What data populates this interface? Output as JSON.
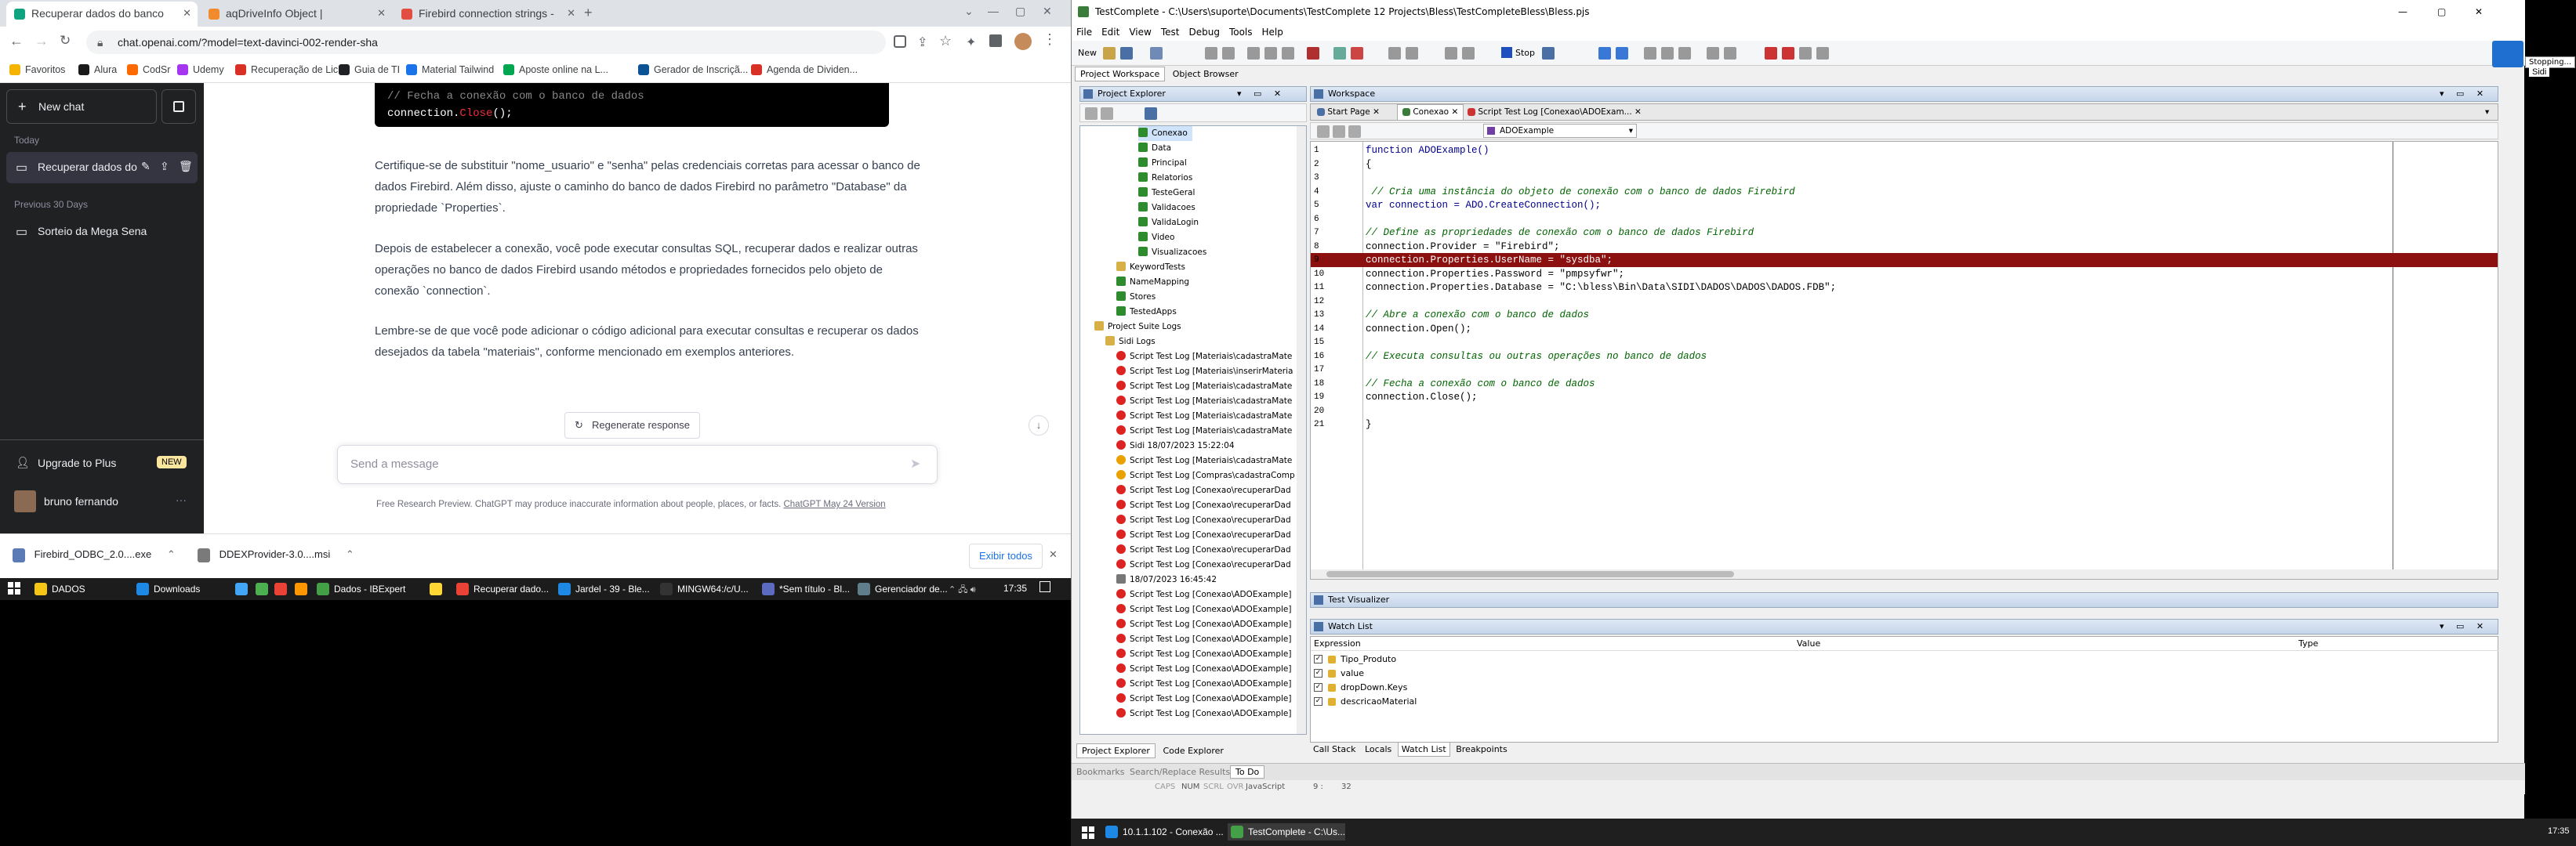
{
  "browser": {
    "tabs": [
      {
        "label": "Recuperar dados do banco",
        "color": "#10a37f"
      },
      {
        "label": "aqDriveInfo Object | TestComplete",
        "color": "#f28b2e"
      },
      {
        "label": "Firebird connection strings - Conn",
        "color": "#e24e42"
      }
    ],
    "url": "chat.openai.com/?model=text-davinci-002-render-sha",
    "bookmarks": [
      {
        "label": "Favoritos",
        "color": "#f5b400"
      },
      {
        "label": "Alura",
        "color": "#1a1a1a"
      },
      {
        "label": "CodSr",
        "color": "#ff6a00"
      },
      {
        "label": "Udemy",
        "color": "#a435f0"
      },
      {
        "label": "Recuperação de Lic...",
        "color": "#d93025"
      },
      {
        "label": "Guia de TI",
        "color": "#202124"
      },
      {
        "label": "Material Tailwind",
        "color": "#1a73e8"
      },
      {
        "label": "Aposte online na L...",
        "color": "#00a650"
      },
      {
        "label": "Gerador de Inscriçã...",
        "color": "#0b5394"
      },
      {
        "label": "Agenda de Dividen...",
        "color": "#d93025"
      }
    ]
  },
  "chatgpt": {
    "new_chat": "New chat",
    "today": "Today",
    "active_chat": "Recuperar dados do",
    "previous": "Previous 30 Days",
    "old_chat": "Sorteio da Mega Sena",
    "upgrade": "Upgrade to Plus",
    "new_badge": "NEW",
    "user": "bruno fernando",
    "code_comment": "// Fecha a conexão com o banco de dados",
    "code_line_1": "connection.",
    "code_line_2": "Close",
    "code_line_3": "();",
    "para1": "Certifique-se de substituir \"nome_usuario\" e \"senha\" pelas credenciais corretas para acessar o banco de dados Firebird. Além disso, ajuste o caminho do banco de dados Firebird no parâmetro \"Database\" da propriedade `Properties`.",
    "para2": "Depois de estabelecer a conexão, você pode executar consultas SQL, recuperar dados e realizar outras operações no banco de dados Firebird usando métodos e propriedades fornecidos pelo objeto de conexão `connection`.",
    "para3": "Lembre-se de que você pode adicionar o código adicional para executar consultas e recuperar os dados desejados da tabela \"materiais\", conforme mencionado em exemplos anteriores.",
    "regenerate": "Regenerate response",
    "placeholder": "Send a message",
    "disclaimer": "Free Research Preview. ChatGPT may produce inaccurate information about people, places, or facts.",
    "disclaimer_link": "ChatGPT May 24 Version"
  },
  "downloads": {
    "files": [
      "Firebird_ODBC_2.0....exe",
      "DDEXProvider-3.0....msi"
    ],
    "show_all": "Exibir todos"
  },
  "taskbar_left": {
    "items": [
      {
        "label": "DADOS",
        "color": "#f5c518"
      },
      {
        "label": "Downloads",
        "color": "#1e88e5"
      },
      {
        "label": "",
        "color": "#42a5f5"
      },
      {
        "label": "",
        "color": "#4caf50"
      },
      {
        "label": "",
        "color": "#ea4335"
      },
      {
        "label": "",
        "color": "#ff9800"
      },
      {
        "label": "Dados - IBExpert",
        "color": "#43a047"
      },
      {
        "label": "",
        "color": "#fdd835"
      },
      {
        "label": "Recuperar dado...",
        "color": "#ea4335"
      },
      {
        "label": "Jardel - 39 - Ble...",
        "color": "#1e88e5"
      },
      {
        "label": "MINGW64:/c/U...",
        "color": "#333"
      },
      {
        "label": "*Sem título - Bl...",
        "color": "#5c6bc0"
      },
      {
        "label": "Gerenciador de...",
        "color": "#607d8b"
      }
    ],
    "time": "17:35"
  },
  "testcomplete": {
    "title": "TestComplete - C:\\Users\\suporte\\Documents\\TestComplete 12 Projects\\Bless\\TestCompleteBless\\Bless.pjs",
    "menus": [
      "File",
      "Edit",
      "View",
      "Test",
      "Debug",
      "Tools",
      "Help"
    ],
    "new_label": "New",
    "stop_label": "Stop",
    "stopping_label": "Stopping...",
    "sidi_label": "Sidi",
    "tabs_top": [
      "Project Workspace",
      "Object Browser"
    ],
    "project_explorer": "Project Explorer",
    "tree": [
      {
        "label": "Conexao",
        "indent": 4,
        "icon": "check"
      },
      {
        "label": "Data",
        "indent": 4,
        "icon": "check"
      },
      {
        "label": "Principal",
        "indent": 4,
        "icon": "check"
      },
      {
        "label": "Relatorios",
        "indent": 4,
        "icon": "check"
      },
      {
        "label": "TesteGeral",
        "indent": 4,
        "icon": "check"
      },
      {
        "label": "Validacoes",
        "indent": 4,
        "icon": "check"
      },
      {
        "label": "ValidaLogin",
        "indent": 4,
        "icon": "check"
      },
      {
        "label": "Video",
        "indent": 4,
        "icon": "check"
      },
      {
        "label": "Visualizacoes",
        "indent": 4,
        "icon": "check"
      },
      {
        "label": "KeywordTests",
        "indent": 2,
        "icon": "folder"
      },
      {
        "label": "NameMapping",
        "indent": 2,
        "icon": "check"
      },
      {
        "label": "Stores",
        "indent": 2,
        "icon": "check"
      },
      {
        "label": "TestedApps",
        "indent": 2,
        "icon": "check"
      },
      {
        "label": "Project Suite Logs",
        "indent": 0,
        "icon": "folder"
      },
      {
        "label": "Sidi Logs",
        "indent": 1,
        "icon": "folder"
      },
      {
        "label": "Script Test Log [Materiais\\cadastraMate",
        "indent": 2,
        "icon": "err"
      },
      {
        "label": "Script Test Log [Materiais\\inserirMateria",
        "indent": 2,
        "icon": "err"
      },
      {
        "label": "Script Test Log [Materiais\\cadastraMate",
        "indent": 2,
        "icon": "err"
      },
      {
        "label": "Script Test Log [Materiais\\cadastraMate",
        "indent": 2,
        "icon": "err"
      },
      {
        "label": "Script Test Log [Materiais\\cadastraMate",
        "indent": 2,
        "icon": "err"
      },
      {
        "label": "Script Test Log [Materiais\\cadastraMate",
        "indent": 2,
        "icon": "err"
      },
      {
        "label": "Sidi 18/07/2023 15:22:04",
        "indent": 2,
        "icon": "err"
      },
      {
        "label": "Script Test Log [Materiais\\cadastraMate",
        "indent": 2,
        "icon": "warn"
      },
      {
        "label": "Script Test Log [Compras\\cadastraComp",
        "indent": 2,
        "icon": "warn"
      },
      {
        "label": "Script Test Log [Conexao\\recuperarDad",
        "indent": 2,
        "icon": "err"
      },
      {
        "label": "Script Test Log [Conexao\\recuperarDad",
        "indent": 2,
        "icon": "err"
      },
      {
        "label": "Script Test Log [Conexao\\recuperarDad",
        "indent": 2,
        "icon": "err"
      },
      {
        "label": "Script Test Log [Conexao\\recuperarDad",
        "indent": 2,
        "icon": "err"
      },
      {
        "label": "Script Test Log [Conexao\\recuperarDad",
        "indent": 2,
        "icon": "err"
      },
      {
        "label": "Script Test Log [Conexao\\recuperarDad",
        "indent": 2,
        "icon": "err"
      },
      {
        "label": "18/07/2023 16:45:42",
        "indent": 2,
        "icon": "doc"
      },
      {
        "label": "Script Test Log [Conexao\\ADOExample]",
        "indent": 2,
        "icon": "err"
      },
      {
        "label": "Script Test Log [Conexao\\ADOExample]",
        "indent": 2,
        "icon": "err"
      },
      {
        "label": "Script Test Log [Conexao\\ADOExample]",
        "indent": 2,
        "icon": "err"
      },
      {
        "label": "Script Test Log [Conexao\\ADOExample]",
        "indent": 2,
        "icon": "err"
      },
      {
        "label": "Script Test Log [Conexao\\ADOExample]",
        "indent": 2,
        "icon": "err"
      },
      {
        "label": "Script Test Log [Conexao\\ADOExample]",
        "indent": 2,
        "icon": "err"
      },
      {
        "label": "Script Test Log [Conexao\\ADOExample]",
        "indent": 2,
        "icon": "err"
      },
      {
        "label": "Script Test Log [Conexao\\ADOExample]",
        "indent": 2,
        "icon": "err"
      },
      {
        "label": "Script Test Log [Conexao\\ADOExample]",
        "indent": 2,
        "icon": "err"
      }
    ],
    "bottom_left_tabs": [
      "Project Explorer",
      "Code Explorer"
    ],
    "bottom_tabs": [
      "Bookmarks",
      "Search/Replace Results",
      "To Do"
    ],
    "workspace": "Workspace",
    "ws_tabs": [
      "Start Page",
      "Conexao",
      "Script Test Log [Conexao\\ADOExam..."
    ],
    "routine": "ADOExample",
    "code": [
      {
        "n": "1",
        "t": "function ADOExample()"
      },
      {
        "n": "2",
        "t": "{"
      },
      {
        "n": "3",
        "t": ""
      },
      {
        "n": "4",
        "t": " // Cria uma instância do objeto de conexão com o banco de dados Firebird"
      },
      {
        "n": "5",
        "t": "var connection = ADO.CreateConnection();"
      },
      {
        "n": "6",
        "t": ""
      },
      {
        "n": "7",
        "t": "// Define as propriedades de conexão com o banco de dados Firebird"
      },
      {
        "n": "8",
        "t": "connection.Provider = \"Firebird\";"
      },
      {
        "n": "9",
        "t": "connection.Properties.UserName = \"sysdba\";"
      },
      {
        "n": "10",
        "t": "connection.Properties.Password = \"pmpsyfwr\";"
      },
      {
        "n": "11",
        "t": "connection.Properties.Database = \"C:\\bless\\Bin\\Data\\SIDI\\DADOS\\DADOS\\DADOS.FDB\";"
      },
      {
        "n": "12",
        "t": ""
      },
      {
        "n": "13",
        "t": "// Abre a conexão com o banco de dados"
      },
      {
        "n": "14",
        "t": "connection.Open();"
      },
      {
        "n": "15",
        "t": ""
      },
      {
        "n": "16",
        "t": "// Executa consultas ou outras operações no banco de dados"
      },
      {
        "n": "17",
        "t": ""
      },
      {
        "n": "18",
        "t": "// Fecha a conexão com o banco de dados"
      },
      {
        "n": "19",
        "t": "connection.Close();"
      },
      {
        "n": "20",
        "t": ""
      },
      {
        "n": "21",
        "t": "}"
      }
    ],
    "highlight_line": "9",
    "test_visualizer": "Test Visualizer",
    "watch_list": "Watch List",
    "watch_headers": [
      "Expression",
      "Value",
      "Type"
    ],
    "watch_items": [
      "Tipo_Produto",
      "value",
      "dropDown.Keys",
      "descricaoMaterial"
    ],
    "debug_tabs": [
      "Call Stack",
      "Locals",
      "Watch List",
      "Breakpoints"
    ],
    "status": [
      "CAPS",
      "NUM",
      "SCRL",
      "OVR",
      "JavaScript",
      "9 :",
      "32"
    ]
  },
  "taskbar_right": {
    "items": [
      {
        "label": "10.1.1.102 - Conexão ...",
        "color": "#1e88e5"
      },
      {
        "label": "TestComplete - C:\\Us...",
        "color": "#43a047"
      }
    ],
    "time": "17:35"
  }
}
